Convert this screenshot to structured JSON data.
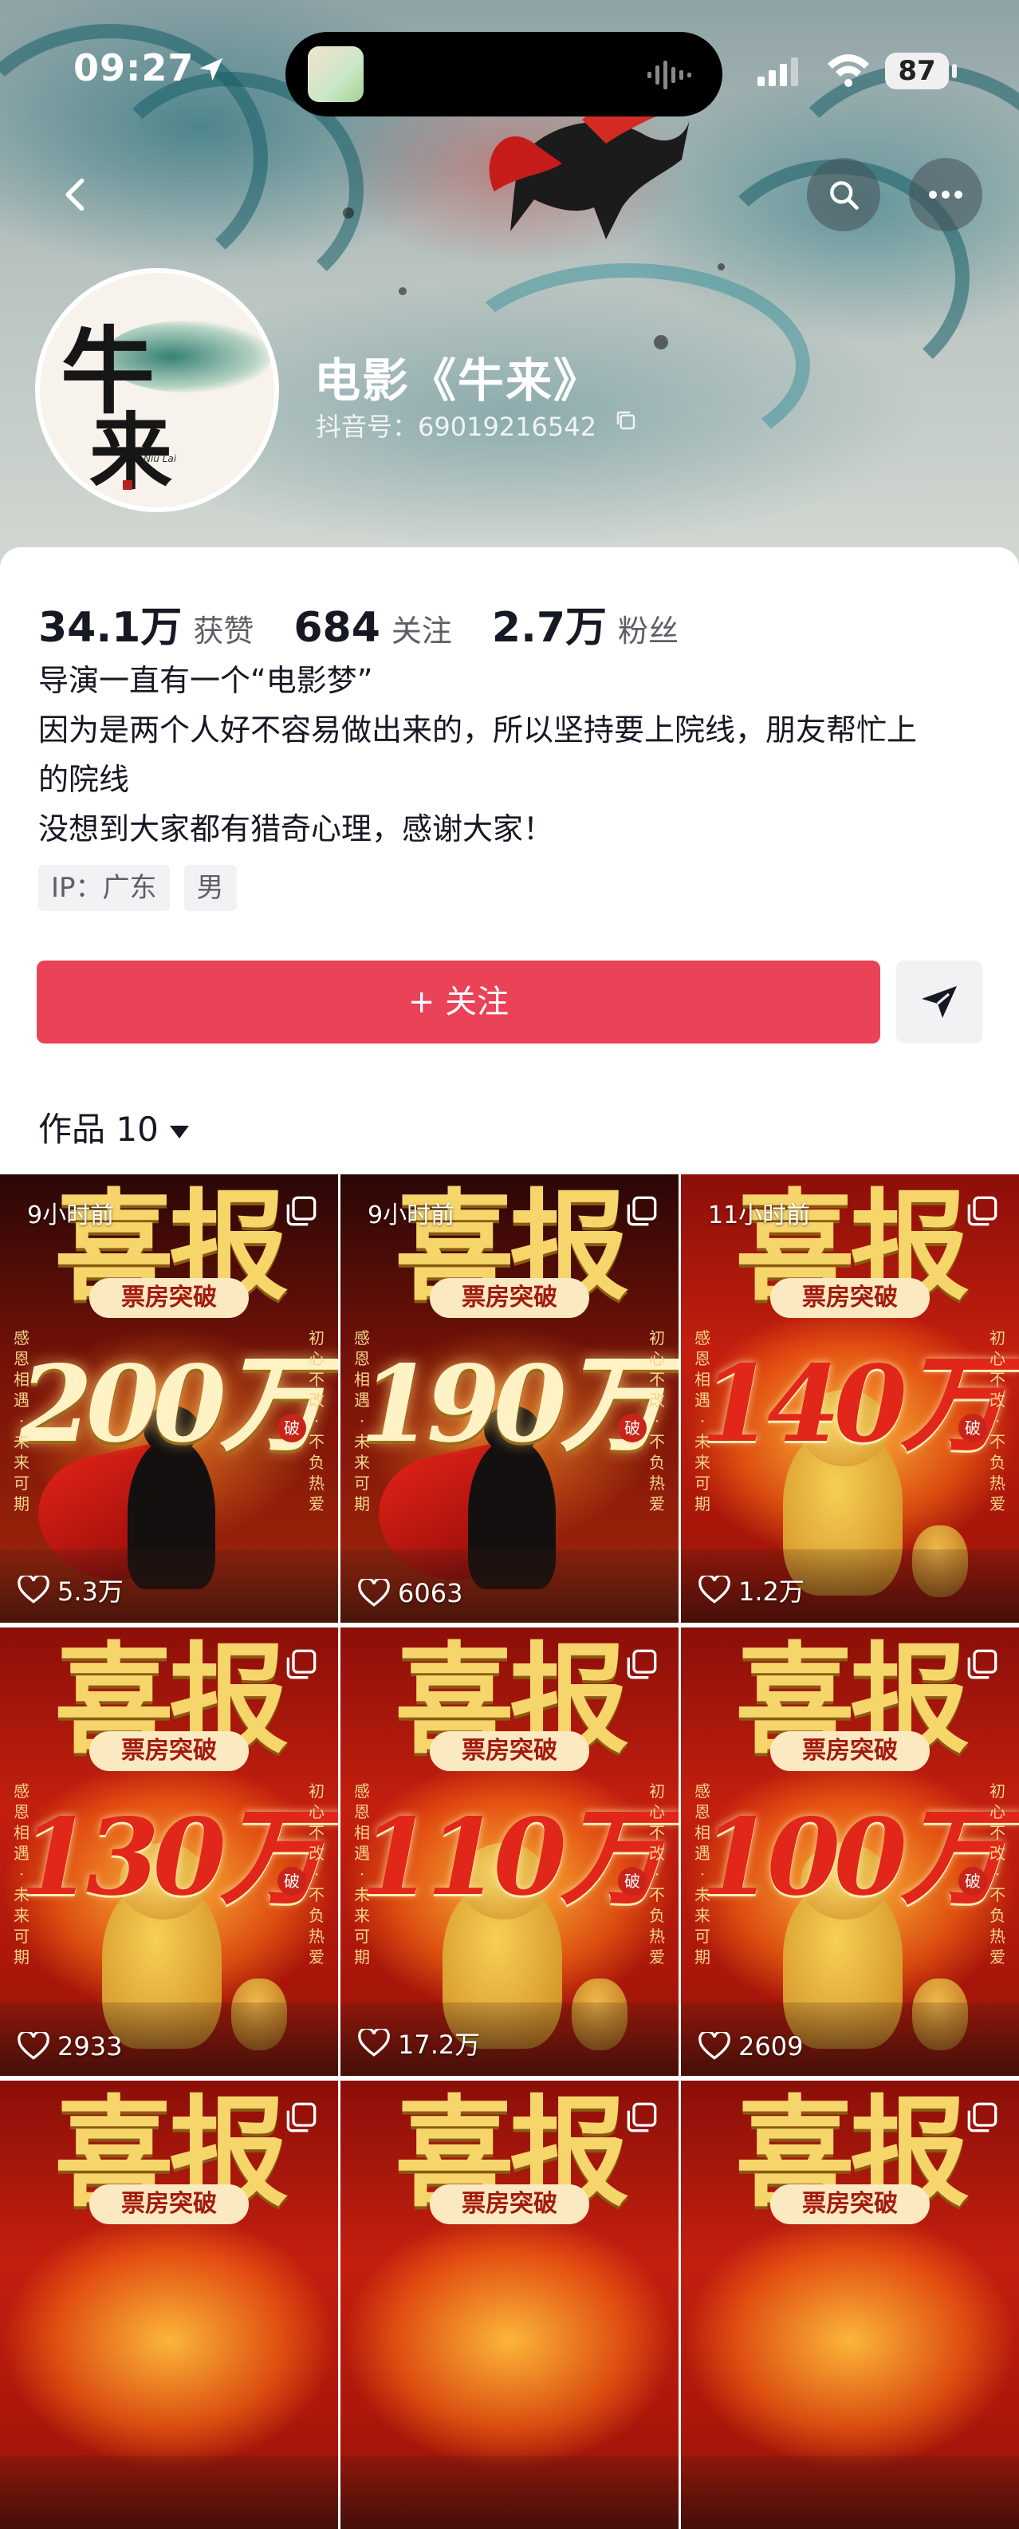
{
  "status_bar": {
    "time": "09:27",
    "battery": "87"
  },
  "profile": {
    "name": "电影《牛来》",
    "douyin_id": "抖音号：69019216542",
    "avatar_text": {
      "char1": "牛",
      "char2": "来",
      "subtitle": "Niu Lai"
    }
  },
  "stats": [
    {
      "value": "34.1万",
      "label": "获赞"
    },
    {
      "value": "684",
      "label": "关注"
    },
    {
      "value": "2.7万",
      "label": "粉丝"
    }
  ],
  "bio": [
    "导演一直有一个“电影梦”",
    "因为是两个人好不容易做出来的，所以坚持要上院线，朋友帮忙上",
    "的院线",
    "没想到大家都有猎奇心理，感谢大家！"
  ],
  "tags": [
    "IP：广东",
    "男"
  ],
  "follow_button": "+ 关注",
  "works_tab": "作品 10",
  "poster_text": {
    "headline": "喜报",
    "sub": "票房突破",
    "left_side": "感恩相遇·未来可期",
    "right_side": "初心不改·不负热爱",
    "stamp": "破",
    "stamp_wan": "万"
  },
  "videos": [
    {
      "time": "9小时前",
      "amount": "200万",
      "likes": "5.3万",
      "style": "gold",
      "art": "bull"
    },
    {
      "time": "9小时前",
      "amount": "190万",
      "likes": "6063",
      "style": "gold",
      "art": "bull"
    },
    {
      "time": "11小时前",
      "amount": "140万",
      "likes": "1.2万",
      "style": "red",
      "art": "mascot"
    },
    {
      "time": "",
      "amount": "130万",
      "likes": "2933",
      "style": "red",
      "art": "mascot"
    },
    {
      "time": "",
      "amount": "110万",
      "likes": "17.2万",
      "style": "red",
      "art": "mascot"
    },
    {
      "time": "",
      "amount": "100万",
      "likes": "2609",
      "style": "red",
      "art": "mascot"
    },
    {
      "time": "",
      "amount": "",
      "likes": "",
      "style": "red",
      "art": "none"
    },
    {
      "time": "",
      "amount": "",
      "likes": "",
      "style": "red",
      "art": "none"
    },
    {
      "time": "",
      "amount": "",
      "likes": "",
      "style": "red",
      "art": "none"
    }
  ],
  "colors": {
    "follow": "#ea4256",
    "tag_bg": "#f2f2f4"
  },
  "icons": [
    "back-icon",
    "search-icon",
    "more-icon",
    "copy-icon",
    "share-icon",
    "multi-image-icon",
    "heart-icon",
    "location-arrow-icon",
    "wifi-icon",
    "signal-icon"
  ]
}
